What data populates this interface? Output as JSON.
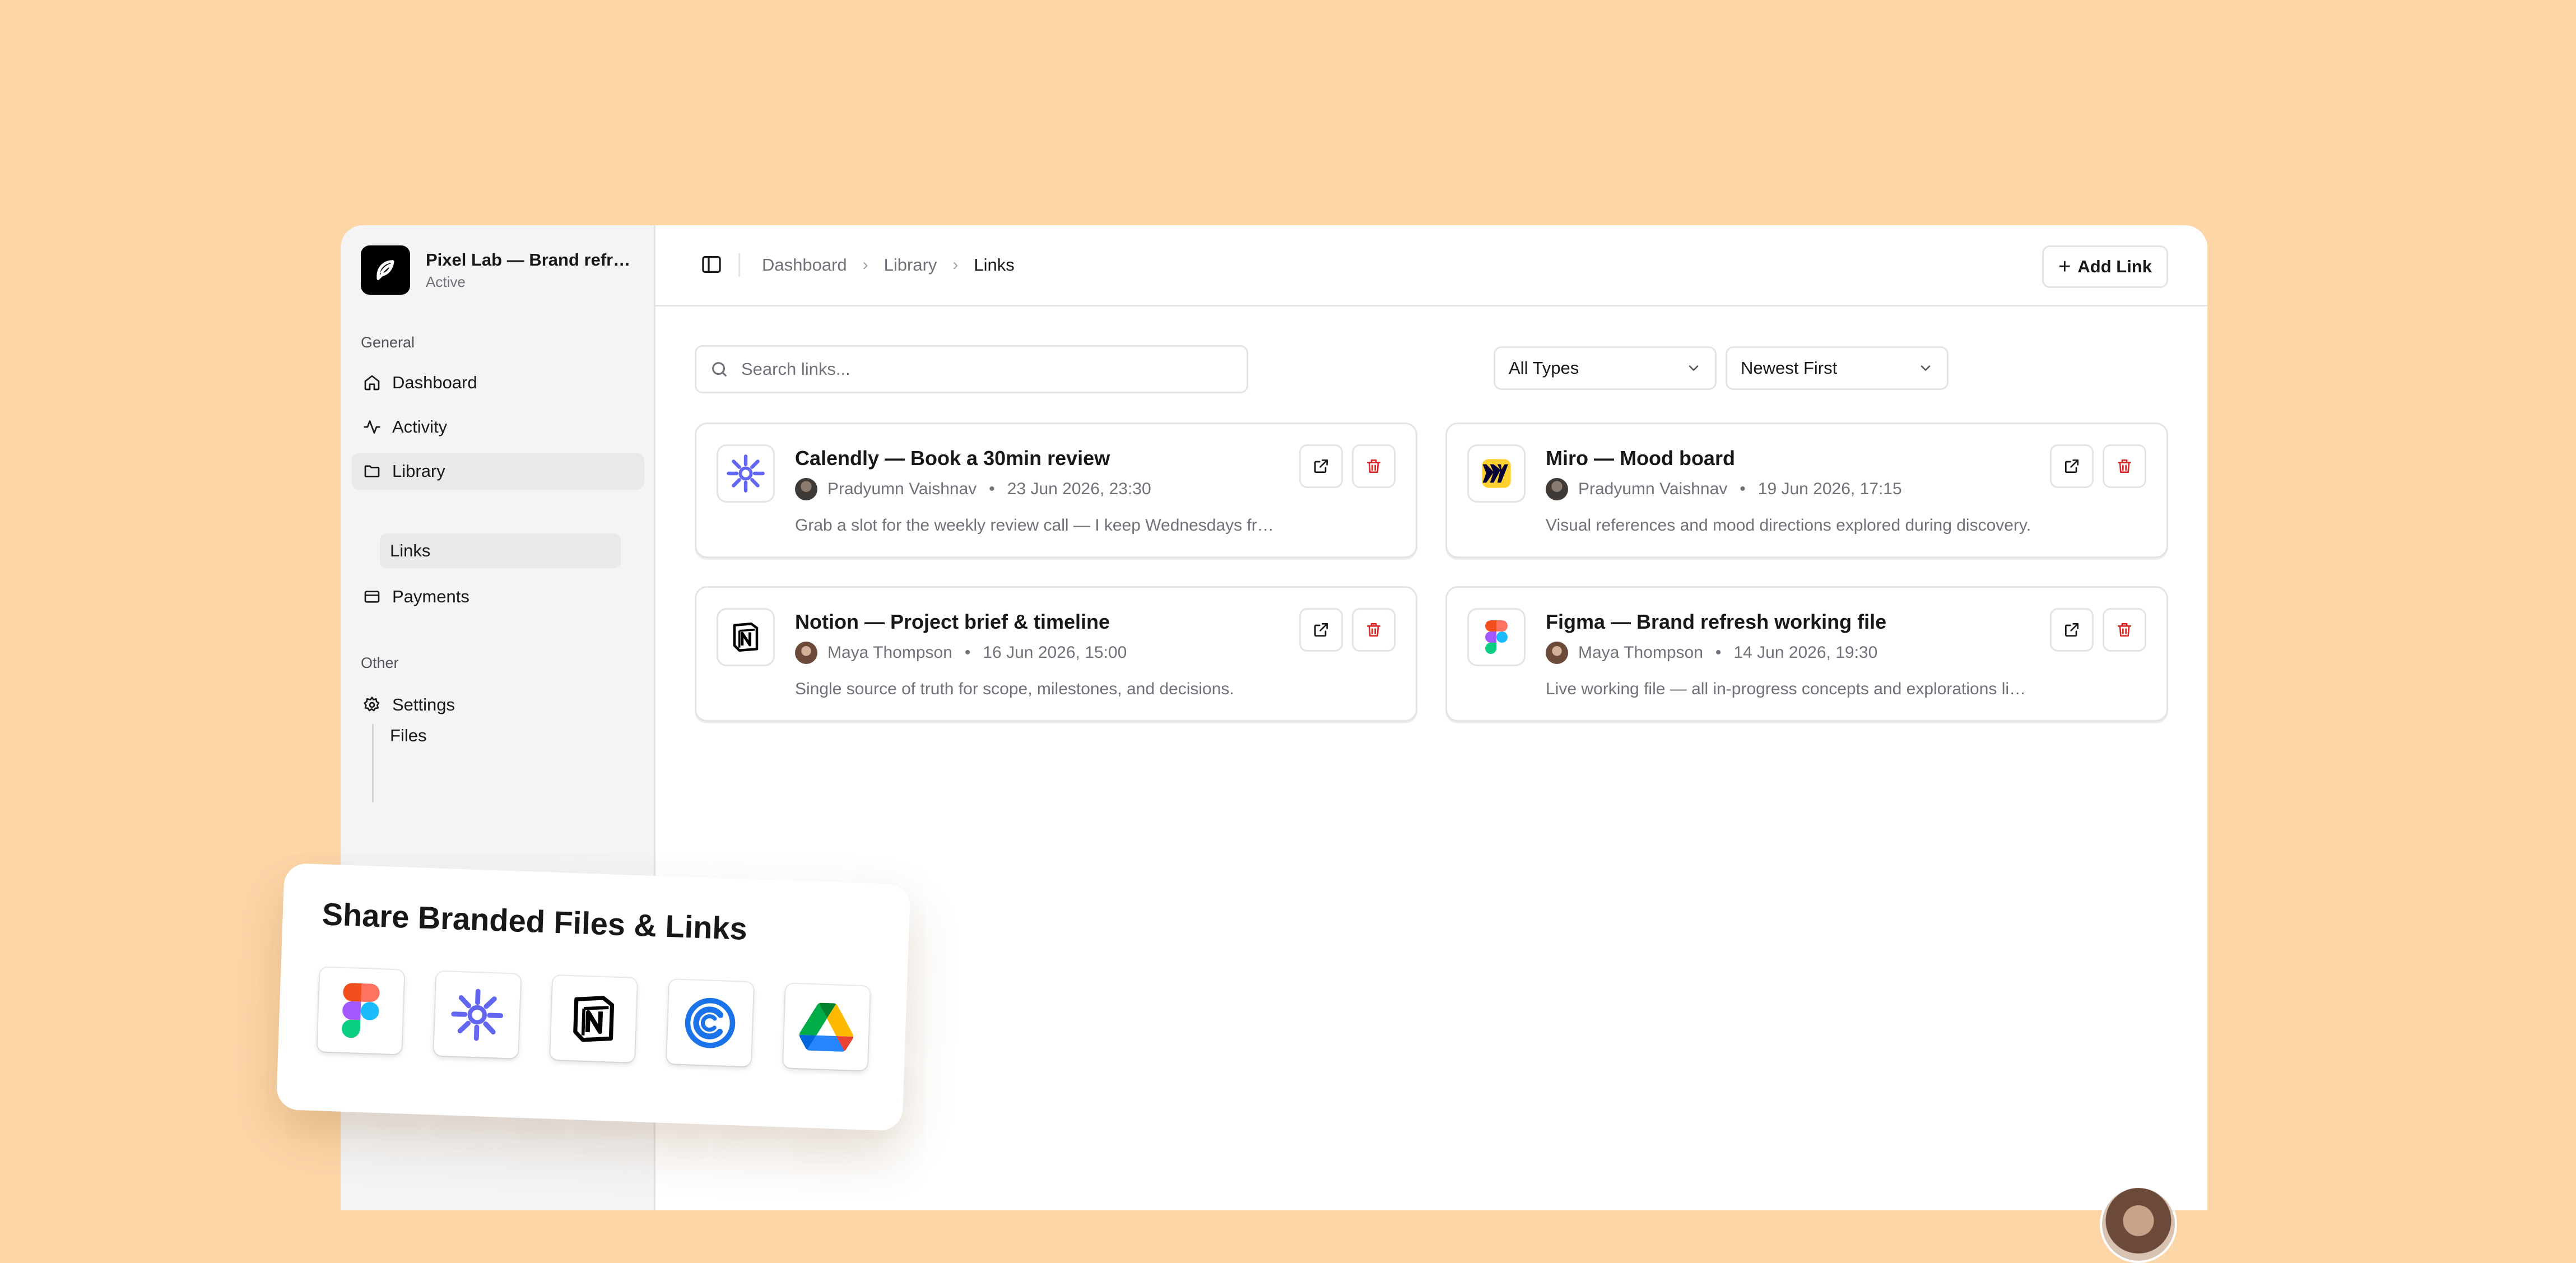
{
  "workspace": {
    "name": "Pixel Lab — Brand refresh",
    "status": "Active"
  },
  "sidebar": {
    "groups": [
      {
        "label": "General"
      },
      {
        "label": "Other"
      }
    ],
    "items": [
      {
        "label": "Dashboard",
        "icon": "home-icon"
      },
      {
        "label": "Activity",
        "icon": "activity-icon"
      },
      {
        "label": "Library",
        "icon": "folder-icon",
        "active": true
      },
      {
        "label": "Payments",
        "icon": "credit-card-icon"
      },
      {
        "label": "Settings",
        "icon": "gear-icon"
      }
    ],
    "subitems": [
      {
        "label": "Files"
      },
      {
        "label": "Links",
        "active": true
      }
    ]
  },
  "breadcrumb": [
    "Dashboard",
    "Library",
    "Links"
  ],
  "toolbar": {
    "add_label": "Add Link"
  },
  "search": {
    "placeholder": "Search links...",
    "value": ""
  },
  "filters": {
    "type_selected": "All Types",
    "sort_selected": "Newest First"
  },
  "cards": [
    {
      "title": "Calendly — Book a 30min review",
      "author": "Pradyumn Vaishnav",
      "date": "23 Jun 2026, 23:30",
      "description": "Grab a slot for the weekly review call — I keep Wednesdays free for this.",
      "icon": "calendly-icon"
    },
    {
      "title": "Miro — Mood board",
      "author": "Pradyumn Vaishnav",
      "date": "19 Jun 2026, 17:15",
      "description": "Visual references and mood directions explored during discovery.",
      "icon": "miro-icon"
    },
    {
      "title": "Notion — Project brief & timeline",
      "author": "Maya Thompson",
      "date": "16 Jun 2026, 15:00",
      "description": "Single source of truth for scope, milestones, and decisions.",
      "icon": "notion-icon"
    },
    {
      "title": "Figma — Brand refresh working file",
      "author": "Maya Thompson",
      "date": "14 Jun 2026, 19:30",
      "description": "Live working file — all in-progress concepts and explorations live here.",
      "icon": "figma-icon"
    }
  ],
  "promo": {
    "title": "Share Branded Files & Links",
    "tiles": [
      "figma-icon",
      "calendly-icon",
      "notion-icon",
      "calendar-c-icon",
      "google-drive-icon"
    ]
  },
  "colors": {
    "background": "#FDD6A8",
    "danger": "#DC2626",
    "calendly": "#6366F1",
    "miro": "#FFD02F"
  },
  "dot": "•"
}
